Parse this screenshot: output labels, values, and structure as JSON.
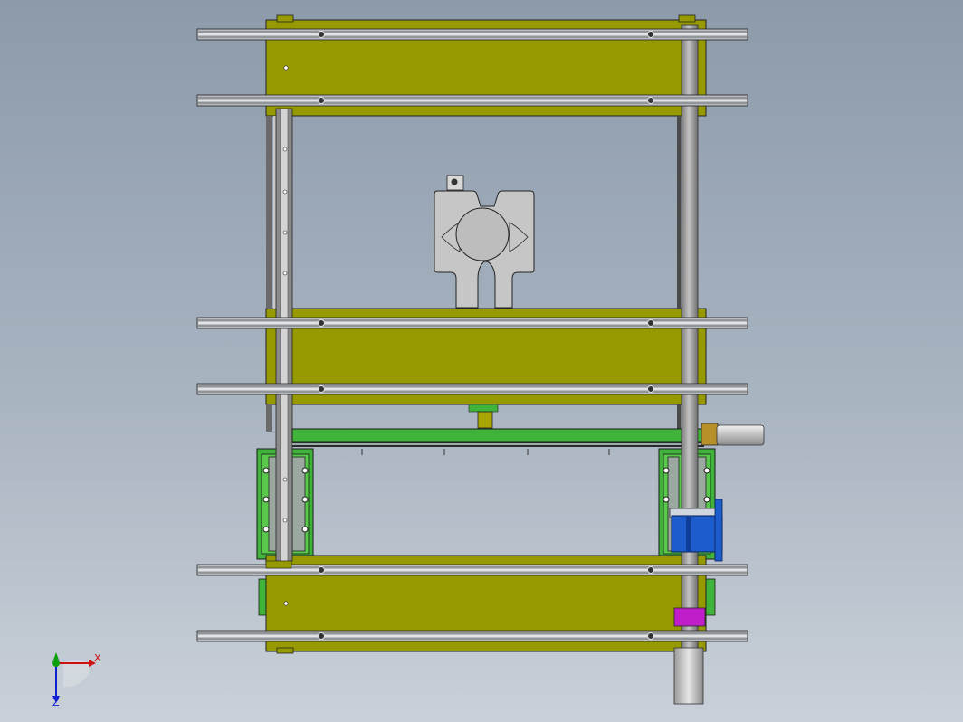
{
  "triad": {
    "x_label": "X",
    "z_label": "Z",
    "colors": {
      "x": "#d01010",
      "y": "#10a010",
      "z": "#1020d0"
    }
  },
  "colors": {
    "background_top": "#8c9aaa",
    "background_bottom": "#c9d0d8",
    "plate_olive": "#969a00",
    "plate_green": "#3fb33a",
    "rail_gray": "#b8bcc0",
    "motor_blue": "#1c5ccc",
    "magenta_block": "#c01ec8",
    "column_gray": "#9a9a9a",
    "cylinder_silver": "#d8d8d8",
    "bracket_bronze": "#b8902a"
  }
}
